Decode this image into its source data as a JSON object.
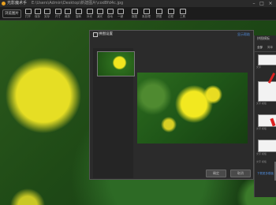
{
  "titlebar": {
    "app_name": "光影魔术手",
    "path": "E:\\Users\\Admin\\Desktop\\新建图片\\cod8fd4c.jpg",
    "controls": [
      "–",
      "□",
      "×"
    ]
  },
  "toolbar": {
    "browse": "浏览图片",
    "tools": [
      "打开",
      "保存",
      "另存",
      "尺寸",
      "裁剪",
      "旋转",
      "补光",
      "减光",
      "自动",
      "一键",
      "抠图",
      "批处理",
      "拼图",
      "边框",
      "工具"
    ]
  },
  "dialog": {
    "title": "拼图设置",
    "link": "显示帮助",
    "ok_label": "确定",
    "cancel_label": "取消"
  },
  "side_panel": {
    "title": "拼图模板",
    "tabs": [
      "全部",
      "简单"
    ],
    "captions": [
      "文字",
      "文字 模板",
      "文字 模板",
      "文字 模板",
      "文字 模板"
    ],
    "footer": "下载更多模板"
  },
  "colors": {
    "accent_red": "#d22222",
    "link_blue": "#4f8ad8"
  }
}
